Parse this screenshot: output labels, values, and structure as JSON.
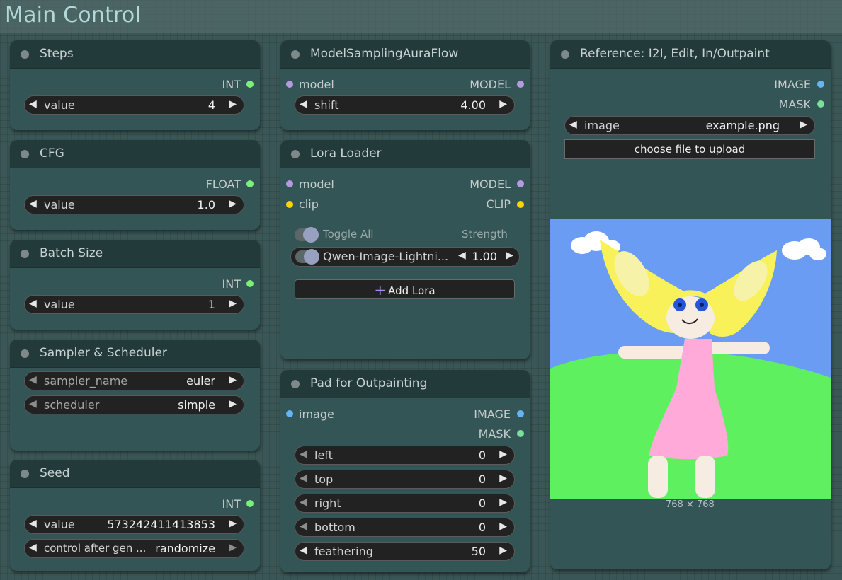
{
  "group": {
    "title": "Main Control"
  },
  "nodes": {
    "steps": {
      "title": "Steps",
      "output": "INT",
      "widget": {
        "name": "value",
        "value": "4"
      }
    },
    "cfg": {
      "title": "CFG",
      "output": "FLOAT",
      "widget": {
        "name": "value",
        "value": "1.0"
      }
    },
    "batch": {
      "title": "Batch Size",
      "output": "INT",
      "widget": {
        "name": "value",
        "value": "1"
      }
    },
    "sampler": {
      "title": "Sampler & Scheduler",
      "sampler_name": {
        "name": "sampler_name",
        "value": "euler"
      },
      "scheduler": {
        "name": "scheduler",
        "value": "simple"
      }
    },
    "seed": {
      "title": "Seed",
      "output": "INT",
      "value": {
        "name": "value",
        "value": "573242411413853"
      },
      "control": {
        "name": "control after gen ...",
        "value": "randomize"
      }
    },
    "msaf": {
      "title": "ModelSamplingAuraFlow",
      "input": "model",
      "output": "MODEL",
      "shift": {
        "name": "shift",
        "value": "4.00"
      }
    },
    "lora": {
      "title": "Lora Loader",
      "inputs": [
        "model",
        "clip"
      ],
      "outputs": [
        "MODEL",
        "CLIP"
      ],
      "toggle_all": "Toggle All",
      "strength_label": "Strength",
      "entry": {
        "name": "Qwen-Image-Lightni...",
        "strength": "1.00"
      },
      "add_label": "Add Lora"
    },
    "pad": {
      "title": "Pad for Outpainting",
      "input": "image",
      "outputs": [
        "IMAGE",
        "MASK"
      ],
      "fields": [
        {
          "name": "left",
          "value": "0"
        },
        {
          "name": "top",
          "value": "0"
        },
        {
          "name": "right",
          "value": "0"
        },
        {
          "name": "bottom",
          "value": "0"
        },
        {
          "name": "feathering",
          "value": "50"
        }
      ]
    },
    "reference": {
      "title": "Reference: I2I, Edit, In/Outpaint",
      "outputs": [
        "IMAGE",
        "MASK"
      ],
      "image": {
        "name": "image",
        "value": "example.png"
      },
      "upload_label": "choose file to upload",
      "dimensions": "768 × 768"
    }
  },
  "colors": {
    "int_slot": "#7cf07a",
    "model_slot": "#b69ae0",
    "clip_slot": "#ffd400",
    "image_slot": "#64b5f6",
    "mask_slot": "#7be09a"
  }
}
